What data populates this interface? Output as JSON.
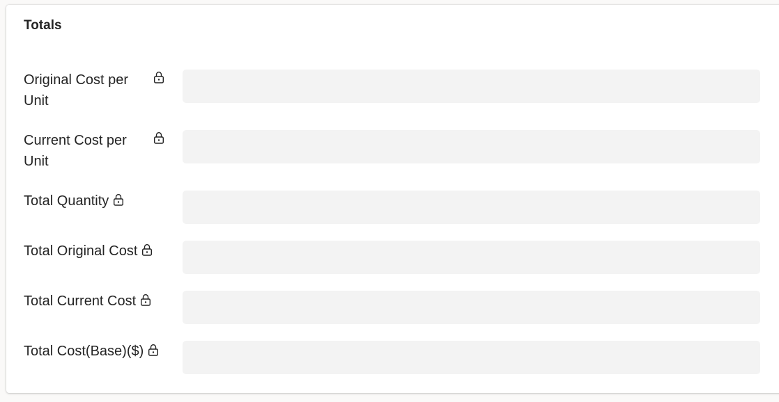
{
  "section": {
    "title": "Totals"
  },
  "fields": [
    {
      "label": "Original Cost per Unit",
      "value": "",
      "locked": true
    },
    {
      "label": "Current Cost per Unit",
      "value": "",
      "locked": true
    },
    {
      "label": "Total Quantity",
      "value": "",
      "locked": true
    },
    {
      "label": "Total Original Cost",
      "value": "",
      "locked": true
    },
    {
      "label": "Total Current Cost",
      "value": "",
      "locked": true
    },
    {
      "label": "Total Cost(Base)($)",
      "value": "",
      "locked": true
    }
  ],
  "icons": {
    "lock": "lock-icon"
  },
  "colors": {
    "field_background": "#f3f3f3",
    "card_background": "#ffffff",
    "text": "#242424"
  }
}
